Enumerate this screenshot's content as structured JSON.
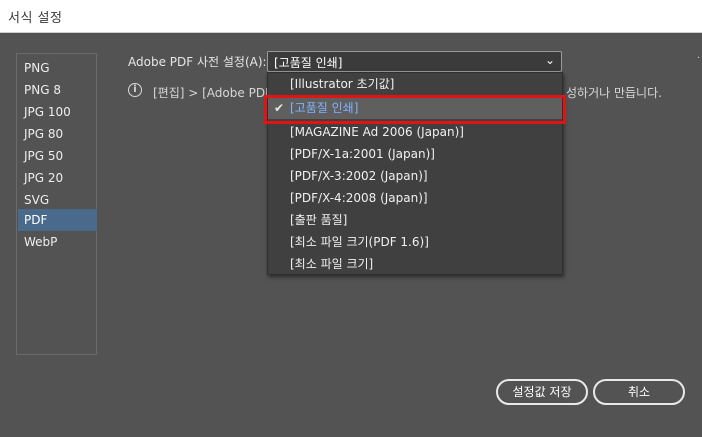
{
  "window": {
    "title": "서식 설정"
  },
  "formats": {
    "items": [
      "PNG",
      "PNG 8",
      "JPG 100",
      "JPG 80",
      "JPG 50",
      "JPG 20",
      "SVG",
      "PDF",
      "WebP"
    ],
    "selected": "PDF"
  },
  "preset": {
    "label": "Adobe PDF 사전 설정(A):",
    "value": "[고품질 인쇄]",
    "options": [
      "[Illustrator 초기값]",
      "[고품질 인쇄]",
      "[MAGAZINE Ad 2006 (Japan)]",
      "[PDF/X-1a:2001 (Japan)]",
      "[PDF/X-3:2002 (Japan)]",
      "[PDF/X-4:2008 (Japan)]",
      "[출판 품질]",
      "[최소 파일 크기(PDF 1.6)]",
      "[최소 파일 크기]"
    ],
    "highlighted_index": 1
  },
  "info": {
    "text_left": "[편집] > [Adobe PDF",
    "text_right": "성하거나 만듭니다."
  },
  "buttons": {
    "save": "설정값 저장",
    "cancel": "취소"
  },
  "colors": {
    "selected_bg": "#4a6a8c",
    "highlight_text": "#7fb2ff",
    "annotation_red": "#e11414"
  }
}
